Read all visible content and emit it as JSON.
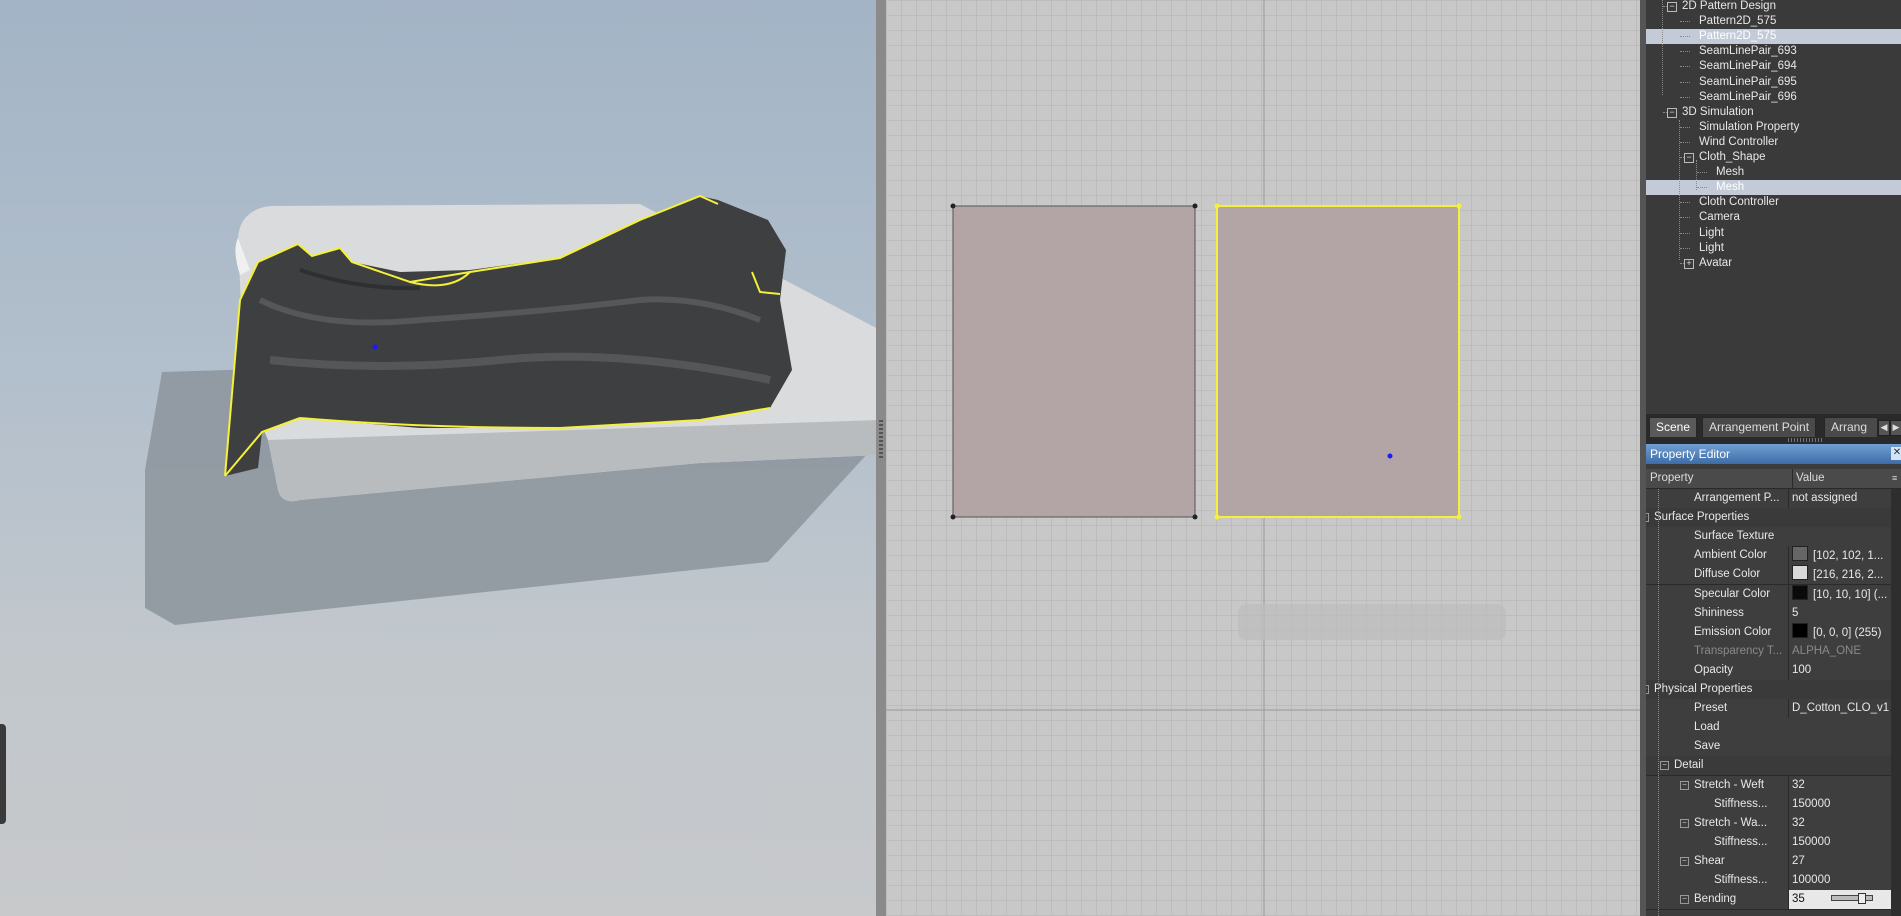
{
  "tree": {
    "items": [
      {
        "label": "2D Pattern Design",
        "depth": 1,
        "expander": "-"
      },
      {
        "label": "Pattern2D_575",
        "depth": 2
      },
      {
        "label": "Pattern2D_575",
        "depth": 2,
        "selected": true
      },
      {
        "label": "SeamLinePair_693",
        "depth": 2
      },
      {
        "label": "SeamLinePair_694",
        "depth": 2
      },
      {
        "label": "SeamLinePair_695",
        "depth": 2
      },
      {
        "label": "SeamLinePair_696",
        "depth": 2
      },
      {
        "label": "3D Simulation",
        "depth": 1,
        "expander": "-"
      },
      {
        "label": "Simulation Property",
        "depth": 2
      },
      {
        "label": "Wind Controller",
        "depth": 2
      },
      {
        "label": "Cloth_Shape",
        "depth": 2,
        "expander": "-"
      },
      {
        "label": "Mesh",
        "depth": 3
      },
      {
        "label": "Mesh",
        "depth": 3,
        "selected": true
      },
      {
        "label": "Cloth Controller",
        "depth": 2
      },
      {
        "label": "Camera",
        "depth": 2
      },
      {
        "label": "Light",
        "depth": 2
      },
      {
        "label": "Light",
        "depth": 2
      },
      {
        "label": "Avatar",
        "depth": 2,
        "expander": "+"
      }
    ]
  },
  "tabs": [
    {
      "label": "Scene",
      "active": true
    },
    {
      "label": "Arrangement Point"
    },
    {
      "label": "Arrang"
    }
  ],
  "property_editor": {
    "title": "Property Editor",
    "col_property": "Property",
    "col_value": "Value",
    "rows": [
      {
        "name": "Arrangement P...",
        "value": "not assigned",
        "depth": 2
      },
      {
        "name": "Surface Properties",
        "depth": 0,
        "group": true,
        "expander": "-"
      },
      {
        "name": "Surface Texture",
        "value": "",
        "depth": 2
      },
      {
        "name": "Ambient Color",
        "value": "[102, 102, 1...",
        "swatch": "#666666",
        "depth": 2
      },
      {
        "name": "Diffuse Color",
        "value": "[216, 216, 2...",
        "swatch": "#d8d8d8",
        "depth": 2
      },
      {
        "name": "Specular Color",
        "value": "[10, 10, 10] (...",
        "swatch": "#0a0a0a",
        "depth": 2
      },
      {
        "name": "Shininess",
        "value": "5",
        "depth": 2
      },
      {
        "name": "Emission Color",
        "value": "[0, 0, 0] (255)",
        "swatch": "#000000",
        "depth": 2
      },
      {
        "name": "Transparency T...",
        "value": "ALPHA_ONE",
        "depth": 2,
        "disabled": true
      },
      {
        "name": "Opacity",
        "value": "100",
        "depth": 2
      },
      {
        "name": "Physical Properties",
        "depth": 0,
        "group": true,
        "expander": "-"
      },
      {
        "name": "Preset",
        "value": "D_Cotton_CLO_v1",
        "depth": 2
      },
      {
        "name": "Load",
        "value": "",
        "depth": 2
      },
      {
        "name": "Save",
        "value": "",
        "depth": 2
      },
      {
        "name": "Detail",
        "depth": 1,
        "group": true,
        "expander": "-"
      },
      {
        "name": "Stretch - Weft",
        "value": "32",
        "depth": 2,
        "expander": "-"
      },
      {
        "name": "Stiffness...",
        "value": "150000",
        "depth": 3
      },
      {
        "name": "Stretch - Wa...",
        "value": "32",
        "depth": 2,
        "expander": "-"
      },
      {
        "name": "Stiffness...",
        "value": "150000",
        "depth": 3
      },
      {
        "name": "Shear",
        "value": "27",
        "depth": 2,
        "expander": "-"
      },
      {
        "name": "Stiffness...",
        "value": "100000",
        "depth": 3
      },
      {
        "name": "Bending",
        "value": "35",
        "depth": 2,
        "expander": "-",
        "slider": true
      }
    ]
  },
  "colors": {
    "selection_outline": "#f5f03a",
    "pattern_fill": "#b3a5a5",
    "tree_selection": "#c3cbd9",
    "title_bar": "#4f82bd"
  }
}
